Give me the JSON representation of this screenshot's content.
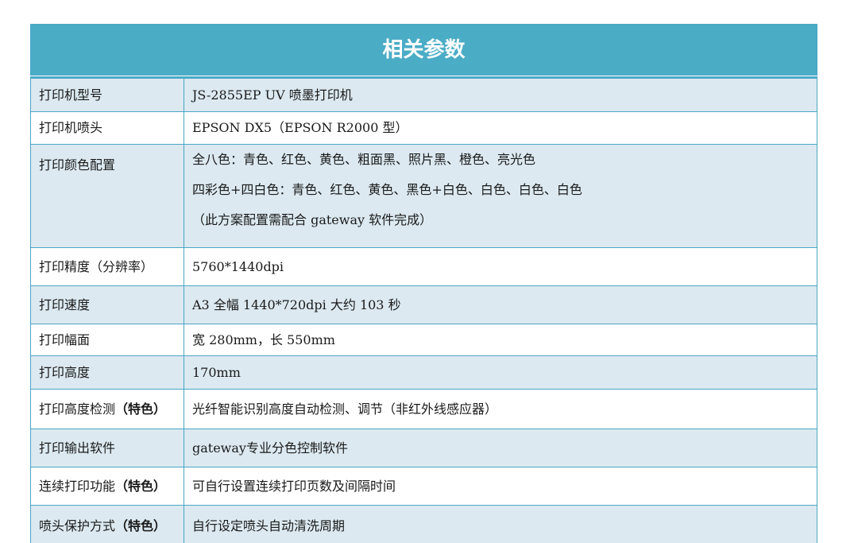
{
  "table": {
    "title": "相关参数",
    "feature_tag": "（特色）",
    "rows": [
      {
        "label": "打印机型号",
        "value": "JS-2855EP UV 喷墨打印机"
      },
      {
        "label": "打印机喷头",
        "value": "EPSON DX5（EPSON R2000 型）"
      },
      {
        "label": "打印颜色配置",
        "lines": [
          "全八色：青色、红色、黄色、粗面黑、照片黑、橙色、亮光色",
          "四彩色+四白色：青色、红色、黄色、黑色+白色、白色、白色、白色",
          "（此方案配置需配合 gateway 软件完成）"
        ]
      },
      {
        "label": "打印精度（分辨率）",
        "value": "5760*1440dpi"
      },
      {
        "label": "打印速度",
        "value": "A3 全幅 1440*720dpi 大约 103 秒"
      },
      {
        "label": "打印幅面",
        "value": "宽 280mm，长 550mm"
      },
      {
        "label": "打印高度",
        "value": "170mm"
      },
      {
        "label": "打印高度检测",
        "value": "光纤智能识别高度自动检测、调节（非红外线感应器）"
      },
      {
        "label": "打印输出软件",
        "value": "gateway专业分色控制软件"
      },
      {
        "label": "连续打印功能",
        "value": "可自行设置连续打印页数及间隔时间"
      },
      {
        "label": "喷头保护方式",
        "value": "自行设定喷头自动清洗周期"
      }
    ]
  }
}
